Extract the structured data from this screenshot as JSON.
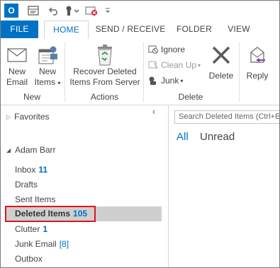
{
  "qat": {
    "app_icon": "O",
    "icons": [
      "outlook-app-icon",
      "send-receive-all-icon",
      "undo-icon",
      "touch-mode-icon",
      "delete-folder-icon",
      "customize-qat-icon"
    ]
  },
  "tabs": [
    {
      "label": "FILE"
    },
    {
      "label": "HOME"
    },
    {
      "label": "SEND / RECEIVE"
    },
    {
      "label": "FOLDER"
    },
    {
      "label": "VIEW"
    }
  ],
  "ribbon": {
    "new_email": {
      "line1": "New",
      "line2": "Email"
    },
    "new_items": {
      "line1": "New",
      "line2": "Items"
    },
    "group_new": "New",
    "recover": {
      "line1": "Recover Deleted",
      "line2": "Items From Server"
    },
    "group_actions": "Actions",
    "ignore": "Ignore",
    "cleanup": "Clean Up",
    "junk": "Junk",
    "delete": "Delete",
    "group_delete": "Delete",
    "reply": "Reply"
  },
  "nav": {
    "favorites": "Favorites",
    "account": "Adam Barr",
    "folders": [
      {
        "name": "Inbox",
        "count": "11"
      },
      {
        "name": "Drafts",
        "count": ""
      },
      {
        "name": "Sent Items",
        "count": ""
      },
      {
        "name": "Deleted Items",
        "count": "105"
      },
      {
        "name": "Clutter",
        "count": "1"
      },
      {
        "name": "Junk Email",
        "count": "[8]"
      },
      {
        "name": "Outbox",
        "count": ""
      }
    ]
  },
  "main": {
    "search_placeholder": "Search Deleted Items (Ctrl+E)",
    "filter_all": "All",
    "filter_unread": "Unread"
  },
  "colors": {
    "accent": "#0072c6",
    "selection_border": "#e0141e",
    "selected_row": "#cfcfcf"
  }
}
